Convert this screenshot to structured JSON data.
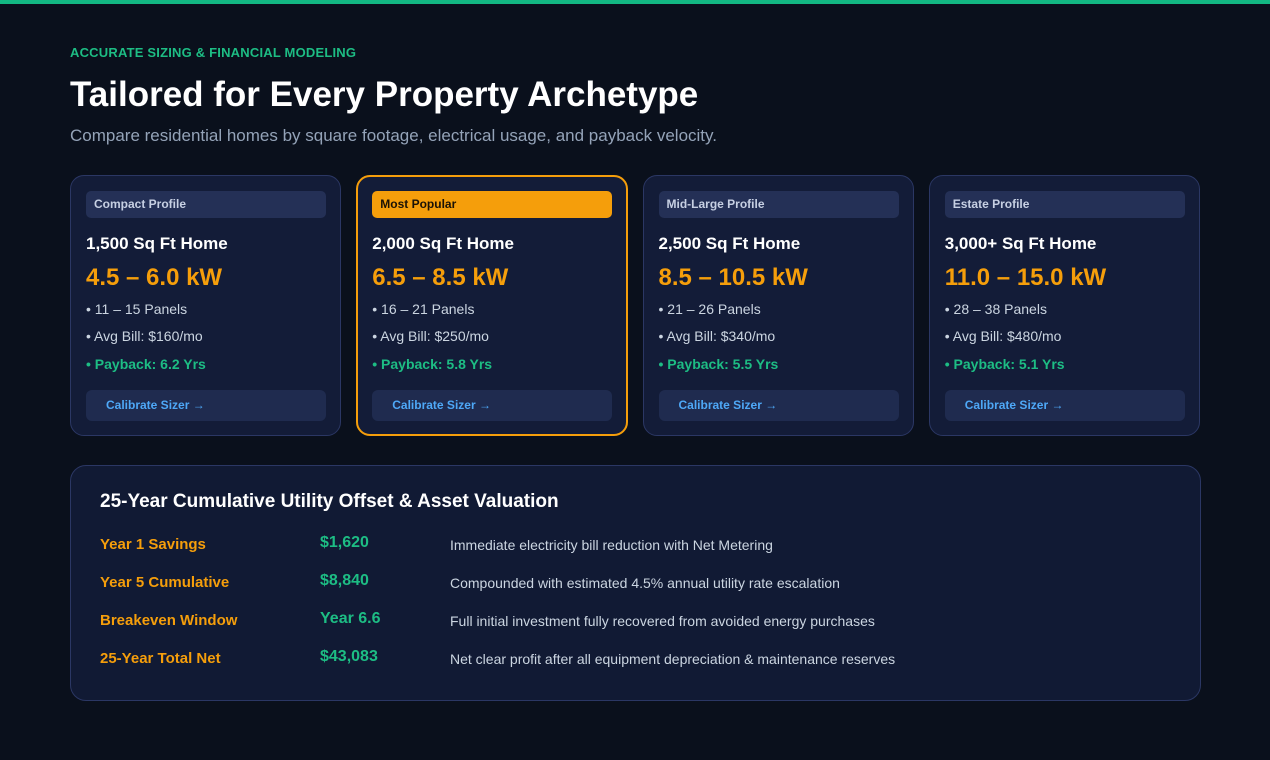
{
  "header": {
    "eyebrow": "ACCURATE SIZING & FINANCIAL MODELING",
    "title": "Tailored for Every Property Archetype",
    "subtitle": "Compare residential homes by square footage, electrical usage, and payback velocity."
  },
  "cards": [
    {
      "badge": "Compact Profile",
      "home": "1,500 Sq Ft Home",
      "kw": "4.5 – 6.0 kW",
      "panels": "• 11 – 15 Panels",
      "bill": "• Avg Bill: $160/mo",
      "payback": "• Payback: 6.2 Yrs",
      "cta": "Calibrate Sizer →"
    },
    {
      "badge": "Most Popular",
      "home": "2,000 Sq Ft Home",
      "kw": "6.5 – 8.5 kW",
      "panels": "• 16 – 21 Panels",
      "bill": "• Avg Bill: $250/mo",
      "payback": "• Payback: 5.8 Yrs",
      "cta": "Calibrate Sizer →"
    },
    {
      "badge": "Mid-Large Profile",
      "home": "2,500 Sq Ft Home",
      "kw": "8.5 – 10.5 kW",
      "panels": "• 21 – 26 Panels",
      "bill": "• Avg Bill: $340/mo",
      "payback": "• Payback: 5.5 Yrs",
      "cta": "Calibrate Sizer →"
    },
    {
      "badge": "Estate Profile",
      "home": "3,000+ Sq Ft Home",
      "kw": "11.0 – 15.0 kW",
      "panels": "• 28 – 38 Panels",
      "bill": "• Avg Bill: $480/mo",
      "payback": "• Payback: 5.1 Yrs",
      "cta": "Calibrate Sizer →"
    }
  ],
  "valuation": {
    "title": "25-Year Cumulative Utility Offset & Asset Valuation",
    "rows": [
      {
        "label": "Year 1 Savings",
        "value": "$1,620",
        "desc": "Immediate electricity bill reduction with Net Metering"
      },
      {
        "label": "Year 5 Cumulative",
        "value": "$8,840",
        "desc": "Compounded with estimated 4.5% annual utility rate escalation"
      },
      {
        "label": "Breakeven Window",
        "value": "Year 6.6",
        "desc": "Full initial investment fully recovered from avoided energy purchases"
      },
      {
        "label": "25-Year Total Net",
        "value": "$43,083",
        "desc": "Net clear profit after all equipment depreciation & maintenance reserves"
      }
    ]
  },
  "colors": {
    "accent_green": "#1dbd84",
    "accent_orange": "#f59e0b",
    "link_blue": "#4ea8f7",
    "background": "#0a101c"
  }
}
